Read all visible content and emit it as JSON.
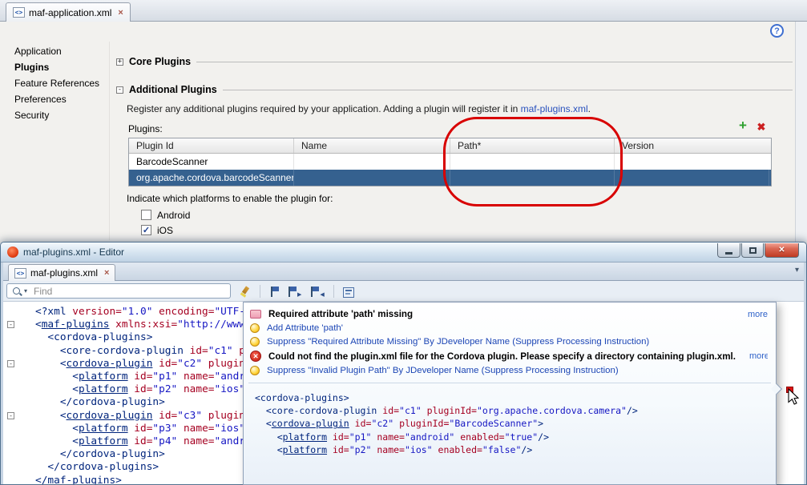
{
  "top": {
    "tab": {
      "label": "maf-application.xml"
    },
    "help": "?",
    "nav": {
      "items": [
        {
          "label": "Application",
          "selected": false
        },
        {
          "label": "Plugins",
          "selected": true
        },
        {
          "label": "Feature References",
          "selected": false
        },
        {
          "label": "Preferences",
          "selected": false
        },
        {
          "label": "Security",
          "selected": false
        }
      ]
    },
    "sections": [
      {
        "title": "Core Plugins",
        "expanded": false
      },
      {
        "title": "Additional Plugins",
        "expanded": true
      }
    ],
    "description": {
      "before": "Register any additional plugins required by your application. Adding a plugin will register it in ",
      "link": "maf-plugins.xml",
      "after": "."
    },
    "plugins": {
      "label": "Plugins:",
      "columns": [
        "Plugin Id",
        "Name",
        "Path*",
        "Version"
      ],
      "rows": [
        {
          "cells": [
            "BarcodeScanner",
            "",
            "",
            ""
          ],
          "selected": false
        },
        {
          "cells": [
            "org.apache.cordova.barcodeScanner",
            "",
            "",
            ""
          ],
          "selected": true
        }
      ]
    },
    "platforms": {
      "label": "Indicate which platforms to enable the plugin for:",
      "options": [
        {
          "label": "Android",
          "checked": false
        },
        {
          "label": "iOS",
          "checked": true
        }
      ]
    }
  },
  "window": {
    "title": "maf-plugins.xml - Editor",
    "tab": {
      "label": "maf-plugins.xml"
    },
    "find": {
      "placeholder": "Find"
    },
    "toolbar_icons": [
      "highlight-icon",
      "toggle-bookmark-icon",
      "next-bookmark-icon",
      "previous-bookmark-icon",
      "editor-view-icon"
    ],
    "code": {
      "lines": [
        {
          "f": 0,
          "t": [
            [
              "<?xml",
              "t"
            ],
            [
              " version=",
              "a"
            ],
            [
              "\"1.0\"",
              "v"
            ],
            [
              " encoding=",
              "a"
            ],
            [
              "\"UTF-",
              "v"
            ]
          ]
        },
        {
          "f": 1,
          "t": [
            [
              "<",
              "t"
            ],
            [
              "maf-plugins",
              "u"
            ],
            [
              " xmlns:xsi=",
              "a"
            ],
            [
              "\"http://www",
              "v"
            ]
          ]
        },
        {
          "f": 0,
          "t": [
            [
              "  ",
              "k"
            ],
            [
              "<cordova-plugins>",
              "t"
            ]
          ]
        },
        {
          "f": 0,
          "t": [
            [
              "    ",
              "k"
            ],
            [
              "<core-cordova-plugin",
              "t"
            ],
            [
              " id=",
              "a"
            ],
            [
              "\"c1\"",
              "v"
            ],
            [
              " pluginId=",
              "a"
            ],
            [
              "\"org.apache.cordova.camera\"",
              "v"
            ],
            [
              "/>",
              "t"
            ]
          ]
        },
        {
          "f": 1,
          "t": [
            [
              "    ",
              "k"
            ],
            [
              "<",
              "t"
            ],
            [
              "cordova-plugin",
              "u"
            ],
            [
              " id=",
              "a"
            ],
            [
              "\"c2\"",
              "v"
            ],
            [
              " pluginId=",
              "a"
            ],
            [
              "\"BarcodeScanner\"",
              "v"
            ],
            [
              ">",
              "t"
            ]
          ]
        },
        {
          "f": 0,
          "t": [
            [
              "      ",
              "k"
            ],
            [
              "<",
              "t"
            ],
            [
              "platform",
              "u"
            ],
            [
              " id=",
              "a"
            ],
            [
              "\"p1\"",
              "v"
            ],
            [
              " name=",
              "a"
            ],
            [
              "\"android\"",
              "v"
            ],
            [
              " enabled=",
              "a"
            ],
            [
              "\"true\"",
              "v"
            ],
            [
              "/>",
              "t"
            ]
          ]
        },
        {
          "f": 0,
          "t": [
            [
              "      ",
              "k"
            ],
            [
              "<",
              "t"
            ],
            [
              "platform",
              "u"
            ],
            [
              " id=",
              "a"
            ],
            [
              "\"p2\"",
              "v"
            ],
            [
              " name=",
              "a"
            ],
            [
              "\"ios\"",
              "v"
            ],
            [
              " enabled=",
              "a"
            ],
            [
              "\"false\"",
              "v"
            ],
            [
              "/>",
              "t"
            ]
          ]
        },
        {
          "f": 0,
          "t": [
            [
              "    ",
              "k"
            ],
            [
              "</cordova-plugin>",
              "t"
            ]
          ]
        },
        {
          "f": 1,
          "t": [
            [
              "    ",
              "k"
            ],
            [
              "<",
              "t"
            ],
            [
              "cordova-plugin",
              "u"
            ],
            [
              " id=",
              "a"
            ],
            [
              "\"c3\"",
              "v"
            ],
            [
              " pluginId=",
              "a"
            ]
          ]
        },
        {
          "f": 0,
          "t": [
            [
              "      ",
              "k"
            ],
            [
              "<",
              "t"
            ],
            [
              "platform",
              "u"
            ],
            [
              " id=",
              "a"
            ],
            [
              "\"p3\"",
              "v"
            ],
            [
              " name=",
              "a"
            ],
            [
              "\"ios\"",
              "v"
            ]
          ]
        },
        {
          "f": 0,
          "t": [
            [
              "      ",
              "k"
            ],
            [
              "<",
              "t"
            ],
            [
              "platform",
              "u"
            ],
            [
              " id=",
              "a"
            ],
            [
              "\"p4\"",
              "v"
            ],
            [
              " name=",
              "a"
            ],
            [
              "\"andr",
              "v"
            ]
          ]
        },
        {
          "f": 0,
          "t": [
            [
              "    ",
              "k"
            ],
            [
              "</cordova-plugin>",
              "t"
            ]
          ]
        },
        {
          "f": 0,
          "t": [
            [
              "  ",
              "k"
            ],
            [
              "</cordova-plugins>",
              "t"
            ]
          ]
        },
        {
          "f": 0,
          "t": [
            [
              "</maf-plugins>",
              "t"
            ]
          ]
        }
      ]
    },
    "popup": {
      "messages": [
        {
          "icon": "xml-error-icon",
          "bold": true,
          "text": "Required attribute 'path' missing",
          "more": "more"
        },
        {
          "icon": "bulb-icon",
          "bold": false,
          "text": "Add Attribute 'path'"
        },
        {
          "icon": "bulb-icon",
          "bold": false,
          "text": "Suppress \"Required Attribute Missing\" By JDeveloper Name (Suppress Processing Instruction)"
        },
        {
          "icon": "error-icon",
          "bold": true,
          "text": "Could not find the plugin.xml file for the Cordova plugin.  Please specify a directory containing plugin.xml.",
          "more": "more"
        },
        {
          "icon": "bulb-icon",
          "bold": false,
          "text": "Suppress \"Invalid Plugin Path\" By JDeveloper Name (Suppress Processing Instruction)"
        }
      ],
      "code_lines": [
        [
          [
            "<cordova-plugins>",
            "t"
          ]
        ],
        [
          [
            "  ",
            "k"
          ],
          [
            "<core-cordova-plugin",
            "t"
          ],
          [
            " id=",
            "a"
          ],
          [
            "\"c1\"",
            "v"
          ],
          [
            " pluginId=",
            "a"
          ],
          [
            "\"org.apache.cordova.camera\"",
            "v"
          ],
          [
            "/>",
            "t"
          ]
        ],
        [
          [
            "  ",
            "k"
          ],
          [
            "<",
            "t"
          ],
          [
            "cordova-plugin",
            "u"
          ],
          [
            " id=",
            "a"
          ],
          [
            "\"c2\"",
            "v"
          ],
          [
            " pluginId=",
            "a"
          ],
          [
            "\"BarcodeScanner\"",
            "v"
          ],
          [
            ">",
            "t"
          ]
        ],
        [
          [
            "    ",
            "k"
          ],
          [
            "<",
            "t"
          ],
          [
            "platform",
            "u"
          ],
          [
            " id=",
            "a"
          ],
          [
            "\"p1\"",
            "v"
          ],
          [
            " name=",
            "a"
          ],
          [
            "\"android\"",
            "v"
          ],
          [
            " enabled=",
            "a"
          ],
          [
            "\"true\"",
            "v"
          ],
          [
            "/>",
            "t"
          ]
        ],
        [
          [
            "    ",
            "k"
          ],
          [
            "<",
            "t"
          ],
          [
            "platform",
            "u"
          ],
          [
            " id=",
            "a"
          ],
          [
            "\"p2\"",
            "v"
          ],
          [
            " name=",
            "a"
          ],
          [
            "\"ios\"",
            "v"
          ],
          [
            " enabled=",
            "a"
          ],
          [
            "\"false\"",
            "v"
          ],
          [
            "/>",
            "t"
          ]
        ]
      ]
    }
  }
}
